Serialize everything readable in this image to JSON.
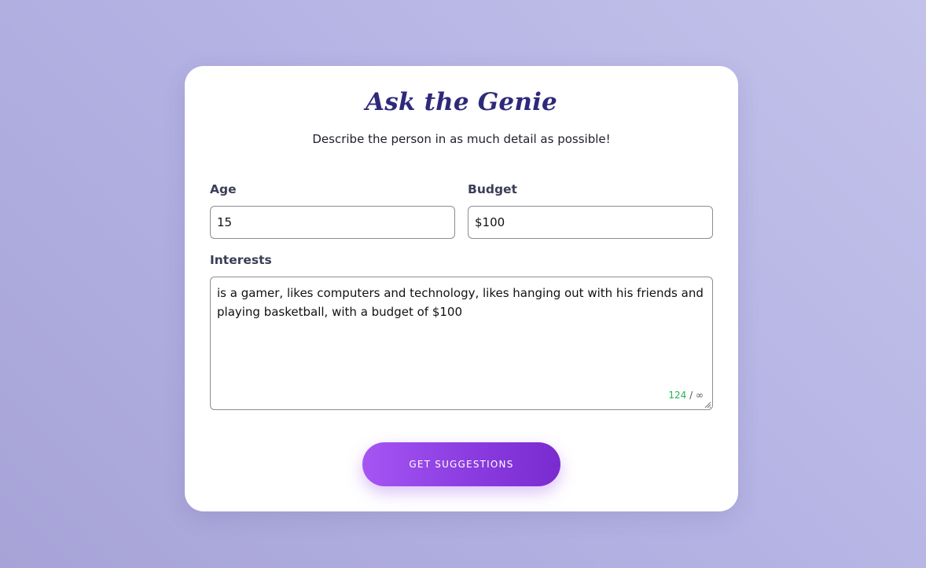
{
  "header": {
    "title": "Ask the Genie",
    "subtitle": "Describe the person in as much detail as possible!"
  },
  "form": {
    "age": {
      "label": "Age",
      "value": "15"
    },
    "budget": {
      "label": "Budget",
      "value": "$100"
    },
    "interests": {
      "label": "Interests",
      "value": "is a gamer, likes computers and technology, likes hanging out with his friends and playing basketball, with a budget of $100",
      "char_count": "124",
      "char_limit": "/ ∞"
    },
    "submit_label": "GET SUGGESTIONS"
  },
  "colors": {
    "accent": "#8a3ce0",
    "title": "#2e2a7a",
    "counter": "#22b35a"
  }
}
